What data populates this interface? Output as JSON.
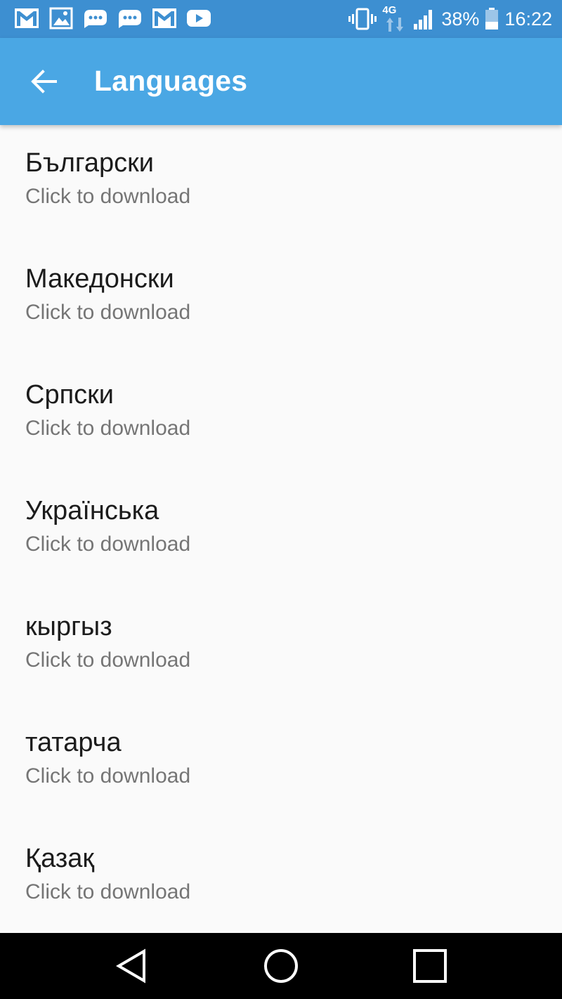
{
  "status_bar": {
    "notification_icons": [
      "gmail-icon",
      "gallery-icon",
      "chat-bubble-icon",
      "chat-bubble-icon",
      "gmail-icon",
      "youtube-icon"
    ],
    "network": "4G",
    "battery_percent": "38%",
    "battery_level": 0.38,
    "time": "16:22"
  },
  "app_bar": {
    "title": "Languages",
    "background_color": "#4aa7e4"
  },
  "languages": [
    {
      "name": "Български",
      "status": "Click to download"
    },
    {
      "name": "Македонски",
      "status": "Click to download"
    },
    {
      "name": "Српски",
      "status": "Click to download"
    },
    {
      "name": "Українська",
      "status": "Click to download"
    },
    {
      "name": "кыргыз",
      "status": "Click to download"
    },
    {
      "name": "татарча",
      "status": "Click to download"
    },
    {
      "name": "Қазақ",
      "status": "Click to download"
    }
  ],
  "nav_bar": {
    "buttons": [
      "back-icon",
      "home-icon",
      "recents-icon"
    ]
  }
}
